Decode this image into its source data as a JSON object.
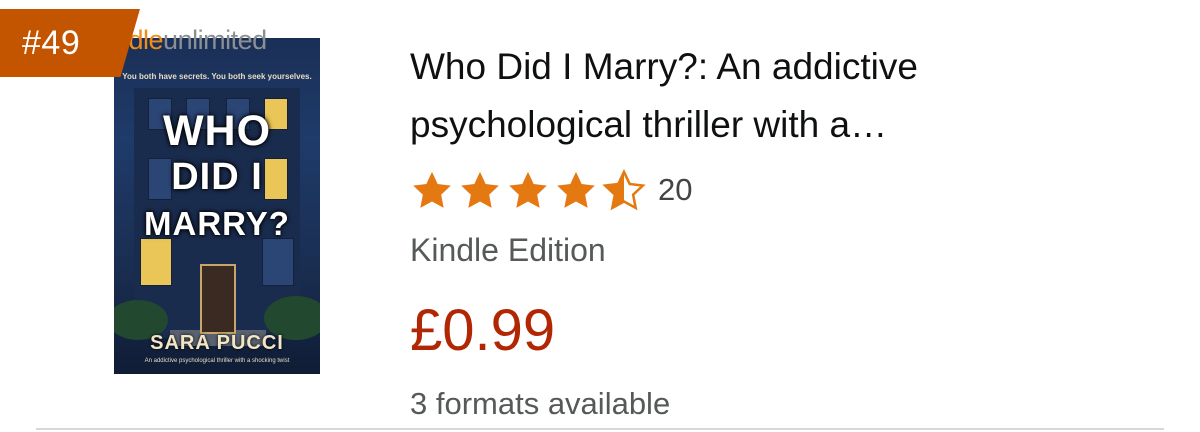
{
  "colors": {
    "badge": "#c45500",
    "star": "#e47911",
    "price": "#b12704"
  },
  "product": {
    "rank": "#49",
    "cover": {
      "brand_prefix": "ndle",
      "brand_suffix": "unlimited",
      "tagline": "You both have secrets. You both seek yourselves.",
      "title_line1": "WHO",
      "title_line2": "DID I",
      "title_line3": "MARRY?",
      "author": "SARA PUCCI",
      "subtitle": "An addictive psychological thriller with a shocking twist"
    },
    "title": "Who Did I Marry?: An addictive psychological thriller with a…",
    "rating": {
      "stars": 4.5,
      "count": "20",
      "icons": [
        "star-full",
        "star-full",
        "star-full",
        "star-full",
        "star-half"
      ]
    },
    "format": "Kindle Edition",
    "price": "£0.99",
    "formats_available": "3 formats available"
  }
}
